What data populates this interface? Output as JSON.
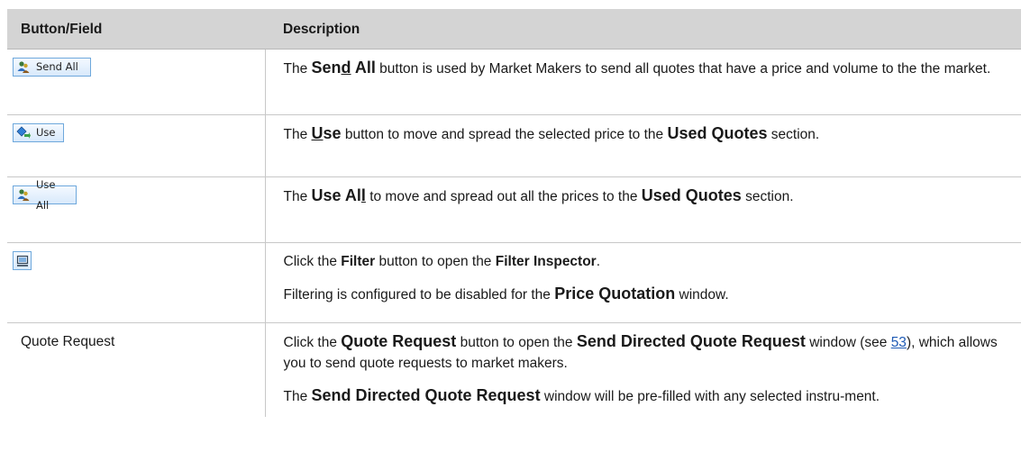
{
  "table": {
    "headers": {
      "field": "Button/Field",
      "description": "Description"
    },
    "rows": [
      {
        "field": {
          "type": "button",
          "label": "Send All",
          "icon": "people-send-icon"
        },
        "description": {
          "prefix": "The ",
          "name_part1": "Sen",
          "name_underlined": "d",
          "name_part2": " All",
          "suffix": " button is used by Market Makers to send all quotes that have a price and volume to the the market."
        }
      },
      {
        "field": {
          "type": "button",
          "label": "Use",
          "icon": "diamond-arrow-icon"
        },
        "description": {
          "prefix": "The ",
          "name_underlined": "U",
          "name_part2": "se",
          "middle": " button to move and spread the selected price to the ",
          "target": "Used Quotes",
          "suffix": " section."
        }
      },
      {
        "field": {
          "type": "button",
          "label": "Use All",
          "icon": "people-send-icon"
        },
        "description": {
          "prefix": "The ",
          "name_part1": "Use Al",
          "name_underlined": "l",
          "middle": " to move and spread out all the prices to the ",
          "target": "Used Quotes",
          "suffix": " section."
        }
      },
      {
        "field": {
          "type": "icon-button",
          "icon": "filter-monitor-icon"
        },
        "description": {
          "p1_prefix": "Click the ",
          "p1_bold1": "Filter",
          "p1_middle": " button to open the ",
          "p1_bold2": "Filter Inspector",
          "p1_suffix": ".",
          "p2_prefix": "Filtering is configured to be disabled for the ",
          "p2_bold": "Price Quotation",
          "p2_suffix": " window."
        }
      },
      {
        "field": {
          "type": "text",
          "label": "Quote Request"
        },
        "description": {
          "p1_prefix": "Click the ",
          "p1_bold1": "Quote Request",
          "p1_middle": " button to open the ",
          "p1_bold2": "Send Directed Quote Request",
          "p1_after": " window (see ",
          "p1_link": "53",
          "p1_suffix": "), which allows you to send quote requests to market makers.",
          "p2_prefix": "The ",
          "p2_bold": "Send Directed Quote Request",
          "p2_suffix": " window will be pre-filled with any selected instru-ment."
        }
      }
    ]
  }
}
